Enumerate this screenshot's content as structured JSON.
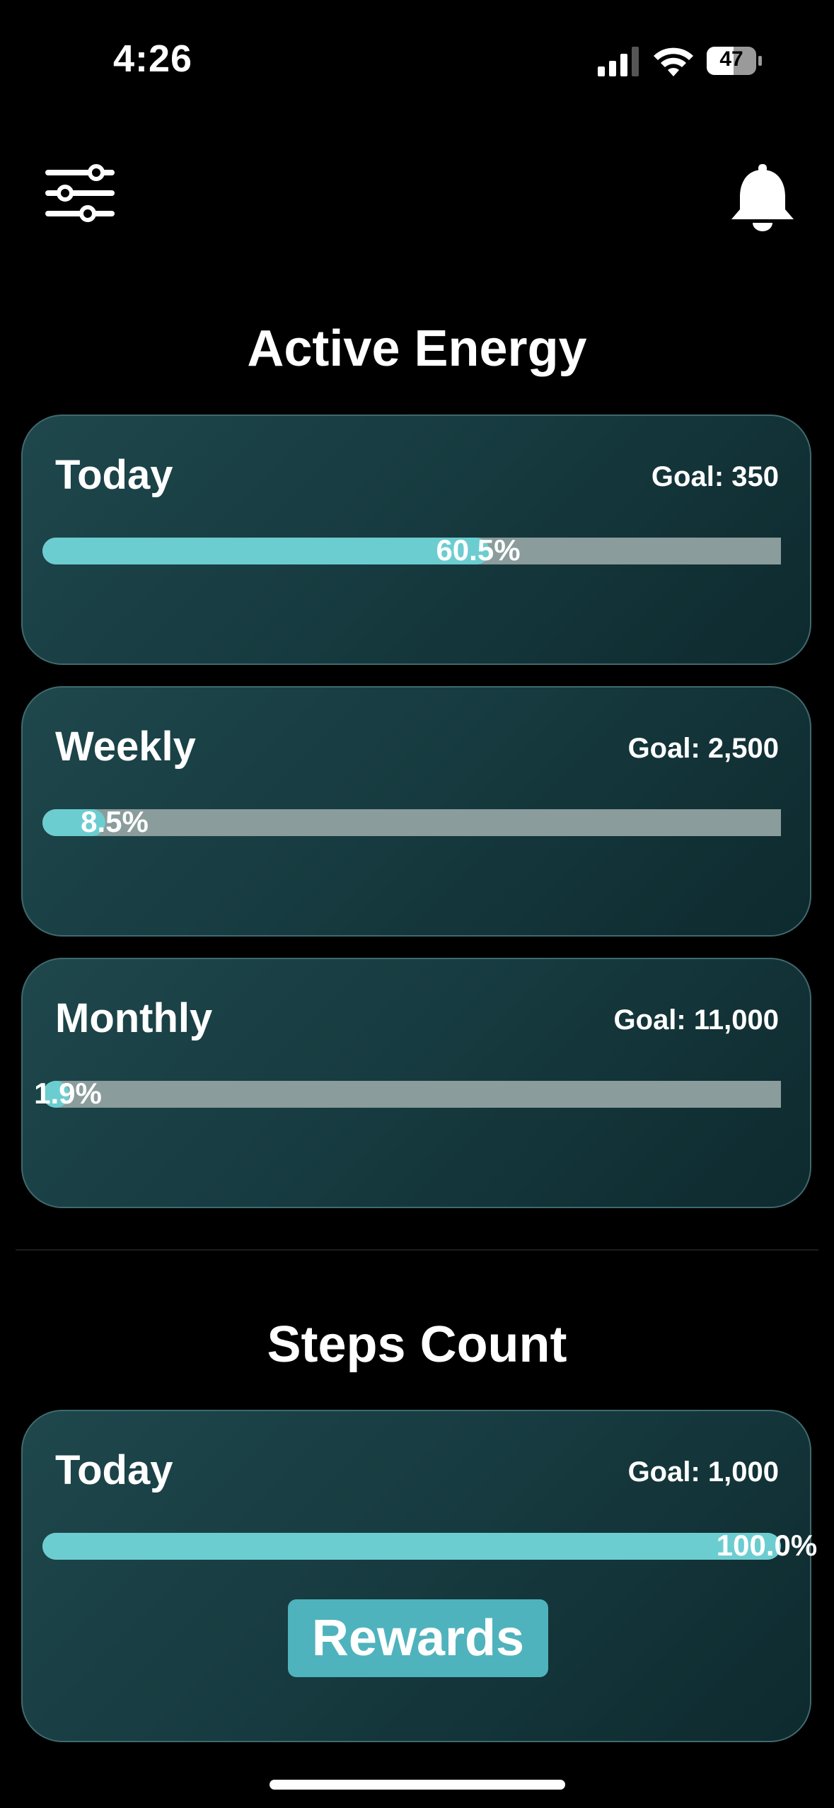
{
  "status_bar": {
    "time": "4:26",
    "battery": "47"
  },
  "icons": {
    "filter": "sliders-icon",
    "notifications": "bell-icon"
  },
  "active_energy": {
    "title": "Active Energy",
    "cards": [
      {
        "label": "Today",
        "goal": "Goal: 350",
        "percent_text": "60.5%",
        "percent": 60.5
      },
      {
        "label": "Weekly",
        "goal": "Goal: 2,500",
        "percent_text": "8.5%",
        "percent": 8.5
      },
      {
        "label": "Monthly",
        "goal": "Goal: 11,000",
        "percent_text": "1.9%",
        "percent": 1.9
      }
    ]
  },
  "steps_count": {
    "title": "Steps Count",
    "cards": [
      {
        "label": "Today",
        "goal": "Goal: 1,000",
        "percent_text": "100.0%",
        "percent": 100.0,
        "button_label": "Rewards"
      }
    ]
  },
  "colors": {
    "background": "#000000",
    "card_top": "#1e474c",
    "card_bottom": "#0e2a2e",
    "card_border": "#3f6a6e",
    "progress_fill": "#6ccdd0",
    "progress_track": "#8a9c9b",
    "rewards_button": "#4fb3bd"
  }
}
